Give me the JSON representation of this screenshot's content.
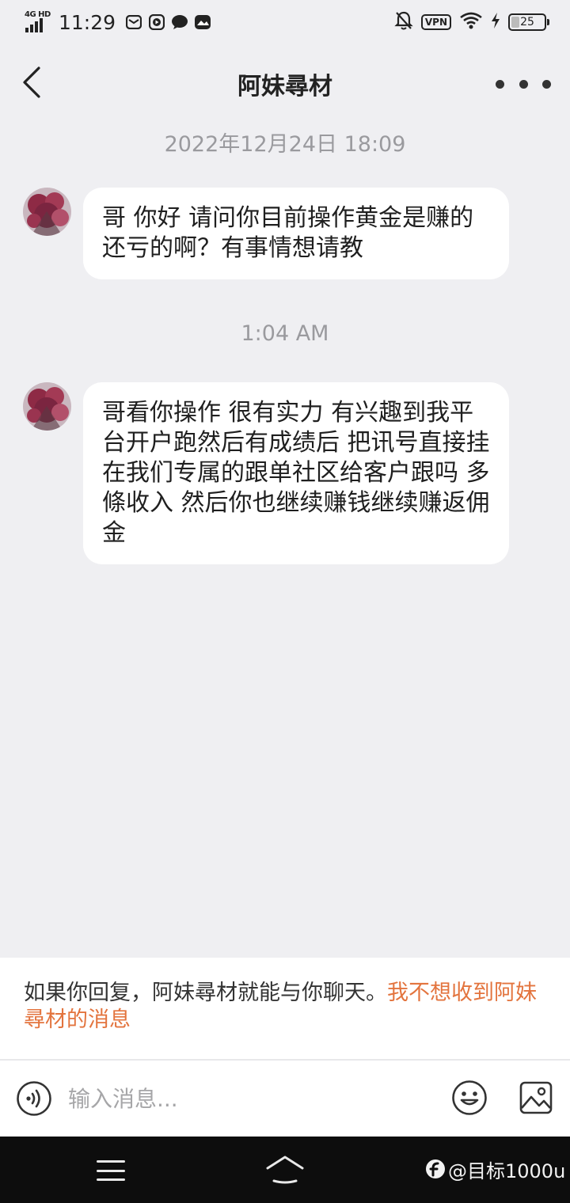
{
  "status_bar": {
    "network": "4G HD",
    "time": "11:29",
    "vpn": "VPN",
    "battery": "25",
    "battery_level": 0.25,
    "icons": [
      "mail-icon",
      "play-icon",
      "chat-icon",
      "album-icon",
      "mute-bell-icon",
      "wifi-icon",
      "charging-icon"
    ]
  },
  "header": {
    "title": "阿妹尋材"
  },
  "messages": [
    {
      "timestamp": "2022年12月24日 18:09",
      "text": "哥 你好 请问你目前操作黄金是赚的还亏的啊？有事情想请教"
    },
    {
      "timestamp": "1:04 AM",
      "text": "哥看你操作 很有实力 有兴趣到我平台开户跑然后有成绩后 把讯号直接挂在我们专属的跟单社区给客户跟吗 多條收入 然后你也继续赚钱继续赚返佣金"
    }
  ],
  "notice": {
    "text": "如果你回复，阿妹尋材就能与你聊天。",
    "link": "我不想收到阿妹尋材的消息"
  },
  "input": {
    "placeholder": "输入消息..."
  },
  "watermark": {
    "text": "@目标1000u"
  },
  "colors": {
    "background": "#efeff2",
    "bubble": "#ffffff",
    "link": "#e3743e",
    "system_nav": "#0d0d0d"
  }
}
